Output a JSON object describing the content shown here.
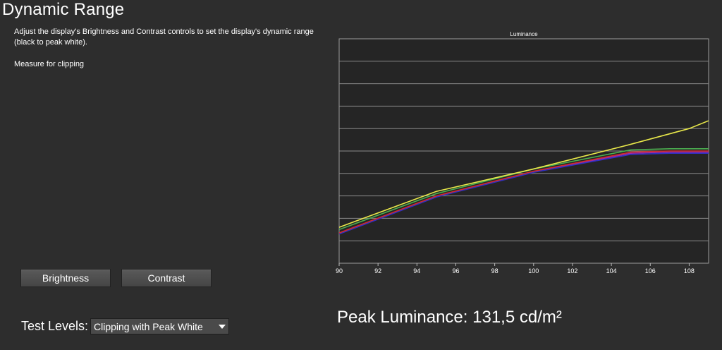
{
  "page": {
    "title": "Dynamic Range",
    "description": "Adjust the display's Brightness and Contrast controls to set the display's dynamic range (black to peak white).",
    "instruction": "Measure for clipping"
  },
  "buttons": {
    "brightness": "Brightness",
    "contrast": "Contrast"
  },
  "test_levels": {
    "label": "Test Levels:",
    "selected": "Clipping with Peak White"
  },
  "peak": {
    "label": "Peak Luminance:",
    "value": "131,5",
    "unit": "cd/m²"
  },
  "colors": {
    "background": "#2d2d2d",
    "plot_background": "#252525",
    "grid": "#8a8a8a"
  },
  "chart_data": {
    "type": "line",
    "title": "Luminance",
    "xlabel": "",
    "ylabel": "",
    "xlim": [
      90,
      109
    ],
    "ylim": [
      0,
      10
    ],
    "x_ticks": [
      "90",
      "92",
      "94",
      "96",
      "98",
      "100",
      "102",
      "104",
      "106",
      "108"
    ],
    "grid": true,
    "series": [
      {
        "color": "#e8e84a",
        "x": [
          90,
          95,
          100,
          105,
          108,
          109
        ],
        "y": [
          1.6,
          3.2,
          4.2,
          5.3,
          6.0,
          6.35
        ]
      },
      {
        "color": "#4caf50",
        "x": [
          90,
          95,
          100,
          105,
          107,
          109
        ],
        "y": [
          1.5,
          3.1,
          4.2,
          5.05,
          5.1,
          5.1
        ]
      },
      {
        "color": "#d22a2a",
        "x": [
          90,
          95,
          100,
          105,
          107,
          109
        ],
        "y": [
          1.35,
          3.0,
          4.1,
          4.95,
          5.0,
          5.0
        ]
      },
      {
        "color": "#3030c0",
        "x": [
          90,
          95,
          100,
          105,
          107,
          109
        ],
        "y": [
          1.3,
          2.95,
          4.05,
          4.85,
          4.9,
          4.9
        ]
      },
      {
        "color": "#9a2ab0",
        "x": [
          90,
          95,
          100,
          105,
          107,
          109
        ],
        "y": [
          1.32,
          2.97,
          4.07,
          4.9,
          4.95,
          4.95
        ]
      }
    ]
  }
}
